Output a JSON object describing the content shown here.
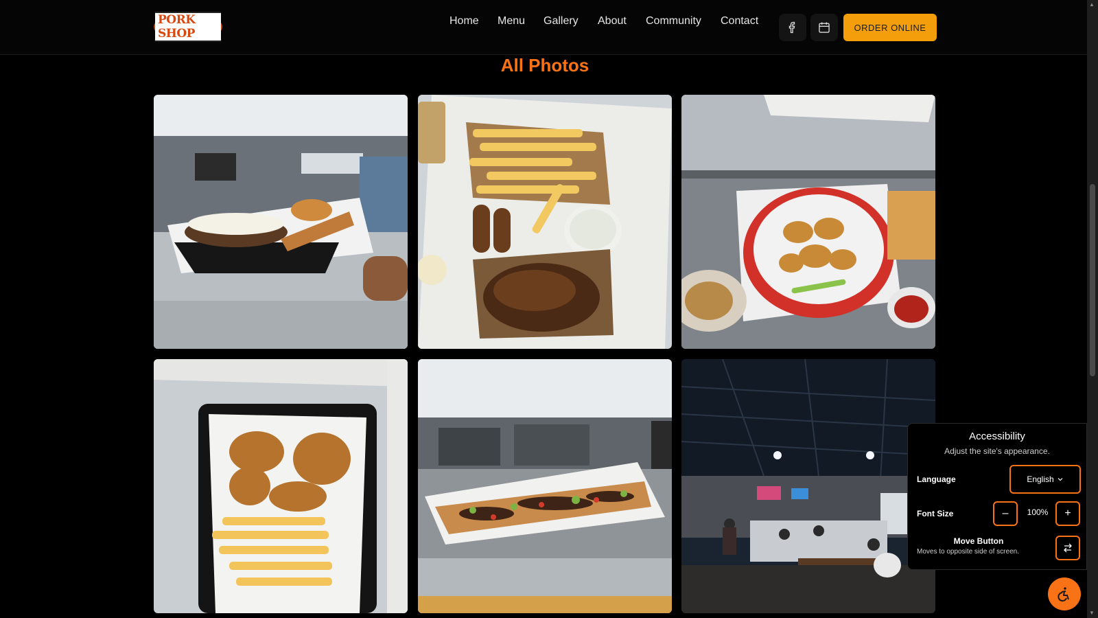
{
  "header": {
    "logo_text": "PORK SHOP",
    "nav": [
      "Home",
      "Menu",
      "Gallery",
      "About",
      "Community",
      "Contact"
    ],
    "order_button": "ORDER ONLINE",
    "icons": [
      "facebook-icon",
      "calendar-icon"
    ]
  },
  "page": {
    "title": "All Photos"
  },
  "gallery": {
    "photos": [
      "burger-basket-photo",
      "fries-pulled-pork-photo",
      "wings-basket-photo",
      "fried-chicken-fries-photo",
      "flatbread-pizza-photo",
      "restaurant-interior-photo"
    ]
  },
  "accessibility": {
    "title": "Accessibility",
    "subtitle": "Adjust the site's appearance.",
    "language_label": "Language",
    "language_value": "English",
    "font_size_label": "Font Size",
    "font_size_value": "100%",
    "decrease_symbol": "–",
    "increase_symbol": "+",
    "move_title": "Move Button",
    "move_subtitle": "Moves to opposite side of screen."
  },
  "colors": {
    "accent": "#f97316",
    "order_button": "#f59e0b",
    "background": "#000000"
  }
}
